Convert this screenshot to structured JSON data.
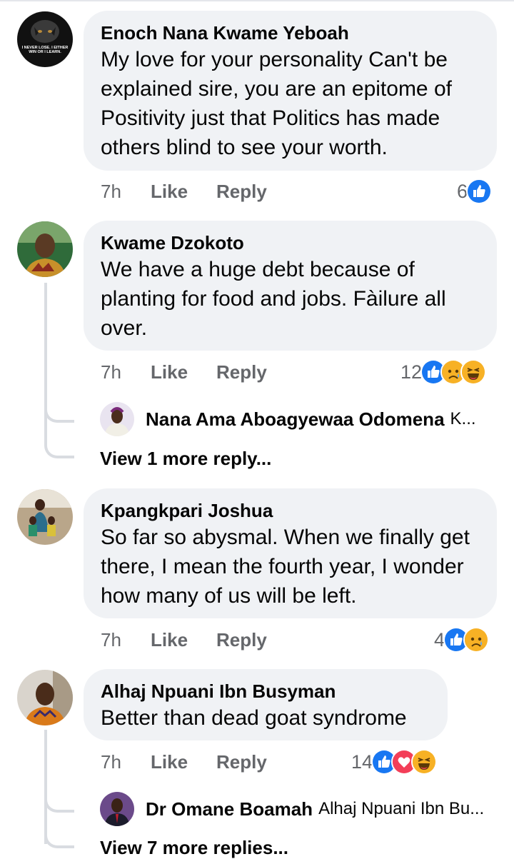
{
  "comments": [
    {
      "author": "Enoch Nana Kwame Yeboah",
      "avatar_text": "I NEVER LOSE. I EITHER WIN OR I LEARN.",
      "text": "My love for your personality  Can't be explained sire, you are an epitome of Positivity just that Politics has made others blind to see your worth.",
      "time": "7h",
      "like_label": "Like",
      "reply_label": "Reply",
      "reaction_count": "6",
      "reactions": [
        "like"
      ]
    },
    {
      "author": "Kwame Dzokoto",
      "text": "We have a huge debt because of planting for food and jobs. Fàilure all over.",
      "time": "7h",
      "like_label": "Like",
      "reply_label": "Reply",
      "reaction_count": "12",
      "reactions": [
        "like",
        "sad",
        "haha"
      ],
      "reply_preview": {
        "author": "Nana Ama Aboagyewaa Odomena",
        "text": "K..."
      },
      "more_replies": "View 1 more reply..."
    },
    {
      "author": "Kpangkpari Joshua",
      "text": "So far so abysmal. When we finally get there, I mean the fourth year, I wonder how many of us will be left.",
      "time": "7h",
      "like_label": "Like",
      "reply_label": "Reply",
      "reaction_count": "4",
      "reactions": [
        "like",
        "sad"
      ]
    },
    {
      "author": "Alhaj Npuani Ibn Busyman",
      "text": "Better than dead goat syndrome",
      "time": "7h",
      "like_label": "Like",
      "reply_label": "Reply",
      "reaction_count": "14",
      "reactions": [
        "like",
        "love",
        "haha"
      ],
      "reply_preview": {
        "author": "Dr Omane Boamah",
        "text": "Alhaj Npuani Ibn Bu..."
      },
      "more_replies": "View 7 more replies..."
    }
  ],
  "colors": {
    "bubble": "#f0f2f5",
    "secondary_text": "#65676b",
    "like_blue": "#1877f2",
    "love_red": "#f33e58",
    "emoji_yellow": "#f7b125"
  }
}
